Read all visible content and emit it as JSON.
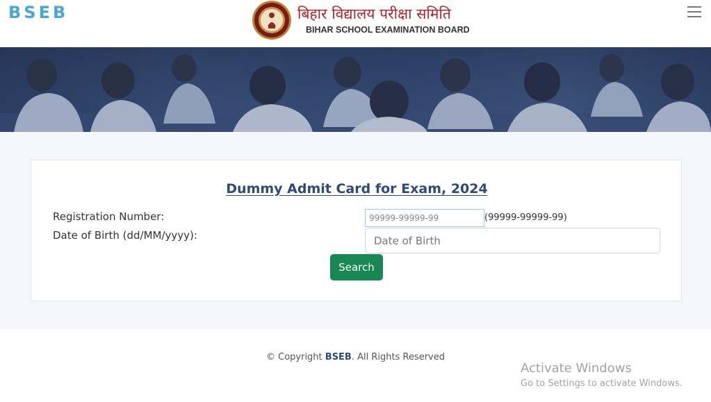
{
  "header": {
    "brand": "BSEB",
    "hindi_name": "बिहार विद्यालय परीक्षा समिति",
    "english_name": "BIHAR SCHOOL EXAMINATION BOARD",
    "menu_icon": "hamburger-menu-icon"
  },
  "form": {
    "title": "Dummy Admit Card for Exam, 2024",
    "reg_label": "Registration Number:",
    "reg_placeholder": "99999-99999-99",
    "reg_hint": "(99999-99999-99)",
    "dob_label": "Date of Birth (dd/MM/yyyy):",
    "dob_placeholder": "Date of Birth",
    "search_label": "Search",
    "button_color": "#198754"
  },
  "footer": {
    "copyright_prefix": "© Copyright ",
    "copyright_brand": "BSEB",
    "copyright_suffix": ". All Rights Reserved"
  },
  "watermark": {
    "line1": "Activate Windows",
    "line2": "Go to Settings to activate Windows."
  }
}
